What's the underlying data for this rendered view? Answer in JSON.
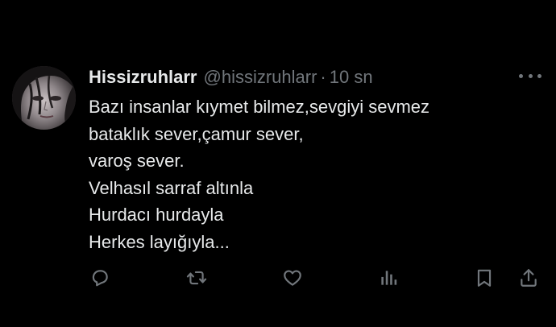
{
  "user": {
    "display_name": "Hissizruhlarr",
    "handle": "@hissizruhlarr",
    "separator": "·",
    "time": "10 sn"
  },
  "tweet": {
    "lines": [
      "Bazı insanlar kıymet bilmez,sevgiyi sevmez",
      "bataklık sever,çamur sever,",
      "varoş sever.",
      "Velhasıl sarraf altınla",
      "Hurdacı hurdayla",
      "Herkes layığıyla..."
    ]
  },
  "icons": {
    "more": "more-horizontal-icon",
    "reply": "reply-icon",
    "retweet": "retweet-icon",
    "like": "heart-icon",
    "views": "analytics-icon",
    "bookmark": "bookmark-icon",
    "share": "share-icon"
  },
  "colors": {
    "background": "#000000",
    "primary_text": "#e7e9ea",
    "secondary_text": "#71767b"
  }
}
